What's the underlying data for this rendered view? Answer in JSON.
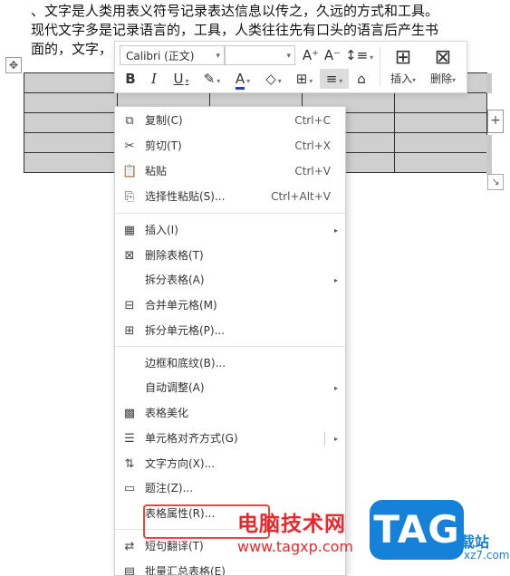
{
  "document": {
    "lines": [
      "、文字是人类用表义符号记录表达信息以传之，久远的方式和工具。",
      "现代文字多是记录语言的，工具，人类往往先有口头的语言后产生书",
      "面的，文字，"
    ]
  },
  "table_handles": {
    "move_icon": "move-cross-icon",
    "add_symbol": "+",
    "resize_symbol": "↘"
  },
  "mini_toolbar": {
    "font_name": "Calibri (正文)",
    "font_size": "",
    "grow_font": "A⁺",
    "shrink_font": "A⁻",
    "line_spacing": "↕≡",
    "bold": "B",
    "italic": "I",
    "underline": "U",
    "highlight": "✎",
    "font_color": "A",
    "shading": "◇",
    "borders": "⊞",
    "align": "≡",
    "clear": "⌂",
    "insert_label": "插入",
    "delete_label": "删除",
    "dropdown_arrow": "▾"
  },
  "context_menu": {
    "items": [
      {
        "label": "复制(C)",
        "shortcut": "Ctrl+C",
        "icon": "⧉"
      },
      {
        "label": "剪切(T)",
        "shortcut": "Ctrl+X",
        "icon": "✂"
      },
      {
        "label": "粘贴",
        "shortcut": "Ctrl+V",
        "icon": "📋"
      },
      {
        "label": "选择性粘贴(S)...",
        "shortcut": "Ctrl+Alt+V",
        "icon": "⎘"
      },
      {
        "label": "插入(I)",
        "shortcut": "",
        "icon": "▦"
      },
      {
        "label": "删除表格(T)",
        "shortcut": "",
        "icon": "⊠"
      },
      {
        "label": "拆分表格(A)",
        "shortcut": "",
        "icon": ""
      },
      {
        "label": "合并单元格(M)",
        "shortcut": "",
        "icon": "⊟"
      },
      {
        "label": "拆分单元格(P)...",
        "shortcut": "",
        "icon": "⊞"
      },
      {
        "label": "边框和底纹(B)...",
        "shortcut": "",
        "icon": ""
      },
      {
        "label": "自动调整(A)",
        "shortcut": "",
        "icon": ""
      },
      {
        "label": "表格美化",
        "shortcut": "",
        "icon": "▩"
      },
      {
        "label": "单元格对齐方式(G)",
        "shortcut": "",
        "icon": "☰"
      },
      {
        "label": "文字方向(X)...",
        "shortcut": "",
        "icon": "⇅"
      },
      {
        "label": "题注(Z)...",
        "shortcut": "",
        "icon": "▭"
      },
      {
        "label": "表格属性(R)...",
        "shortcut": "",
        "icon": ""
      },
      {
        "label": "短句翻译(T)",
        "shortcut": "",
        "icon": "⇄"
      },
      {
        "label": "批量汇总表格(E)",
        "shortcut": "",
        "icon": "▤"
      }
    ],
    "submenu_arrow": "▸"
  },
  "watermark": {
    "site_cn": "电脑技术网",
    "url": "www.tagxp.com",
    "logo": "TAG",
    "site2_cn": "载站",
    "site2_url": "xz7.com"
  },
  "colors": {
    "highlight_red": "#e8473e",
    "watermark_red": "#e8282b",
    "logo_blue": "#1581d8",
    "table_cell_gray": "#cfcfcf"
  }
}
